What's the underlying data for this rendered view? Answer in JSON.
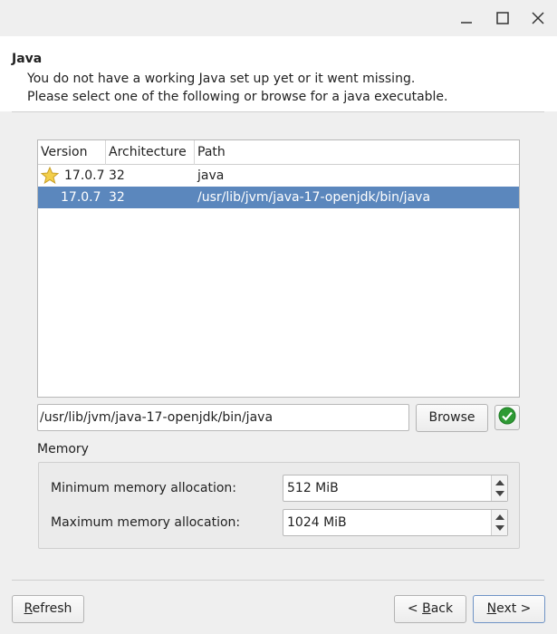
{
  "window": {
    "controls": [
      "minimize-icon",
      "maximize-icon",
      "close-icon"
    ]
  },
  "header": {
    "title": "Java",
    "line1": "You do not have a working Java set up yet or it went missing.",
    "line2": "Please select one of the following or browse for a java executable."
  },
  "table": {
    "columns": [
      "Version",
      "Architecture",
      "Path"
    ],
    "rows": [
      {
        "version": "17.0.7",
        "arch": "32",
        "path": "java",
        "icon": "star-icon",
        "selected": false
      },
      {
        "version": "17.0.7",
        "arch": "32",
        "path": "/usr/lib/jvm/java-17-openjdk/bin/java",
        "icon": "",
        "selected": true
      }
    ]
  },
  "path_field": {
    "value": "/usr/lib/jvm/java-17-openjdk/bin/java"
  },
  "browse_label": "Browse",
  "check_icon": "check-icon",
  "memory": {
    "section_label": "Memory",
    "min_label": "Minimum memory allocation:",
    "min_value": "512 MiB",
    "max_label": "Maximum memory allocation:",
    "max_value": "1024 MiB"
  },
  "footer": {
    "refresh_first": "R",
    "refresh_rest": "efresh",
    "back_prefix": "< ",
    "back_first": "B",
    "back_rest": "ack",
    "next_first": "N",
    "next_rest": "ext >"
  },
  "colors": {
    "selection": "#5b87bd",
    "ok_green": "#2e9a34"
  }
}
